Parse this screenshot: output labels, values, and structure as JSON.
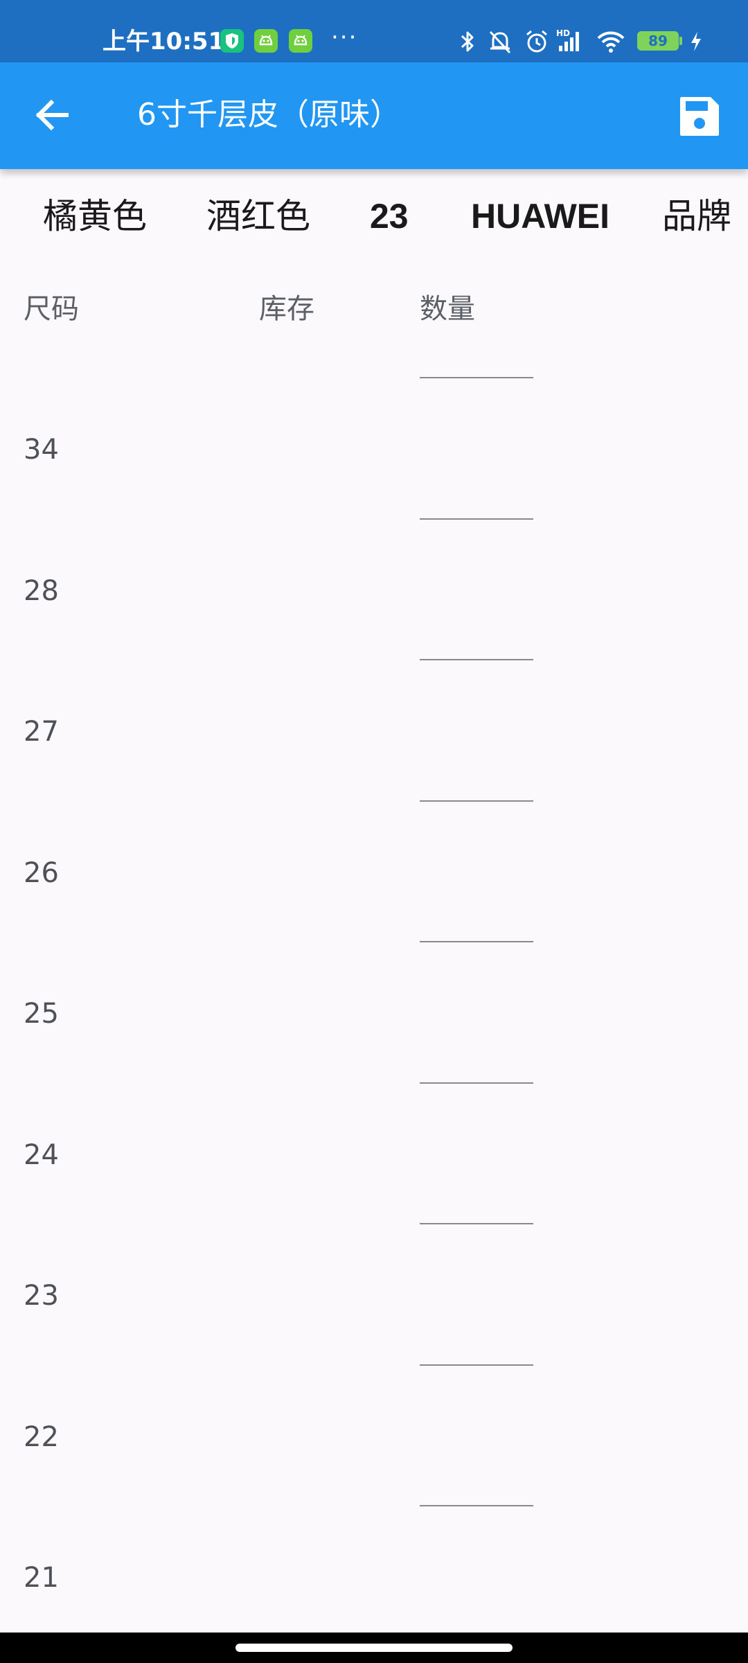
{
  "status_bar": {
    "time": "上午10:51",
    "more": "···",
    "battery": "89",
    "icons": [
      "shield-icon",
      "android-icon",
      "android-icon",
      "bluetooth-icon",
      "bell-off-icon",
      "alarm-icon",
      "signal-icon",
      "wifi-icon",
      "battery-icon",
      "charging-icon"
    ],
    "color": "#1e6fc2"
  },
  "app_bar": {
    "title": "6寸千层皮（原味）",
    "color": "#2196f3",
    "back_icon": "arrow-back-icon",
    "save_icon": "save-icon"
  },
  "attributes": [
    "橘黄色",
    "酒红色",
    "23",
    "HUAWEI",
    "品牌"
  ],
  "table": {
    "headers": {
      "size": "尺码",
      "stock": "库存",
      "quantity": "数量"
    },
    "rows": [
      {
        "size": "34",
        "stock": "",
        "quantity": ""
      },
      {
        "size": "28",
        "stock": "",
        "quantity": ""
      },
      {
        "size": "27",
        "stock": "",
        "quantity": ""
      },
      {
        "size": "26",
        "stock": "",
        "quantity": ""
      },
      {
        "size": "25",
        "stock": "",
        "quantity": ""
      },
      {
        "size": "24",
        "stock": "",
        "quantity": ""
      },
      {
        "size": "23",
        "stock": "",
        "quantity": ""
      },
      {
        "size": "22",
        "stock": "",
        "quantity": ""
      },
      {
        "size": "21",
        "stock": "",
        "quantity": ""
      }
    ]
  }
}
